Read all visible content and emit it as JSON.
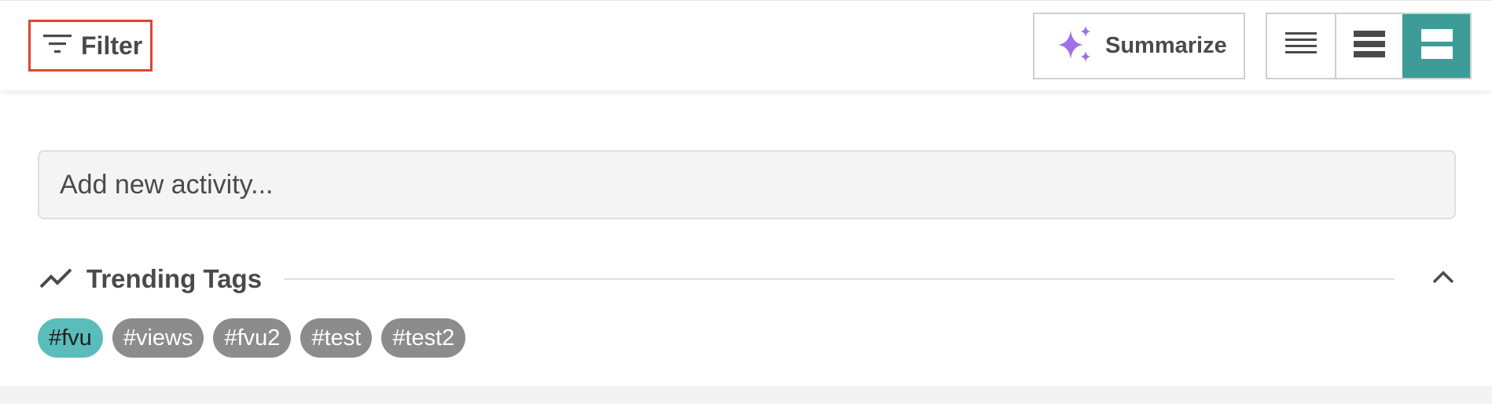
{
  "toolbar": {
    "filter_label": "Filter",
    "summarize_label": "Summarize",
    "view_modes": [
      {
        "name": "compact",
        "icon": "list-compact-icon",
        "active": false
      },
      {
        "name": "normal",
        "icon": "list-normal-icon",
        "active": false
      },
      {
        "name": "expanded",
        "icon": "list-expanded-icon",
        "active": true
      }
    ]
  },
  "activity": {
    "placeholder": "Add new activity..."
  },
  "trending": {
    "title": "Trending Tags",
    "tags": [
      {
        "label": "#fvu",
        "active": true
      },
      {
        "label": "#views",
        "active": false
      },
      {
        "label": "#fvu2",
        "active": false
      },
      {
        "label": "#test",
        "active": false
      },
      {
        "label": "#test2",
        "active": false
      }
    ]
  },
  "colors": {
    "accent": "#3d9c98",
    "tag_active": "#5bbdbb",
    "tag_default": "#8c8c8c",
    "sparkle": "#a070e8",
    "focus_outline": "#e0452f",
    "text": "#4a4a4a"
  }
}
